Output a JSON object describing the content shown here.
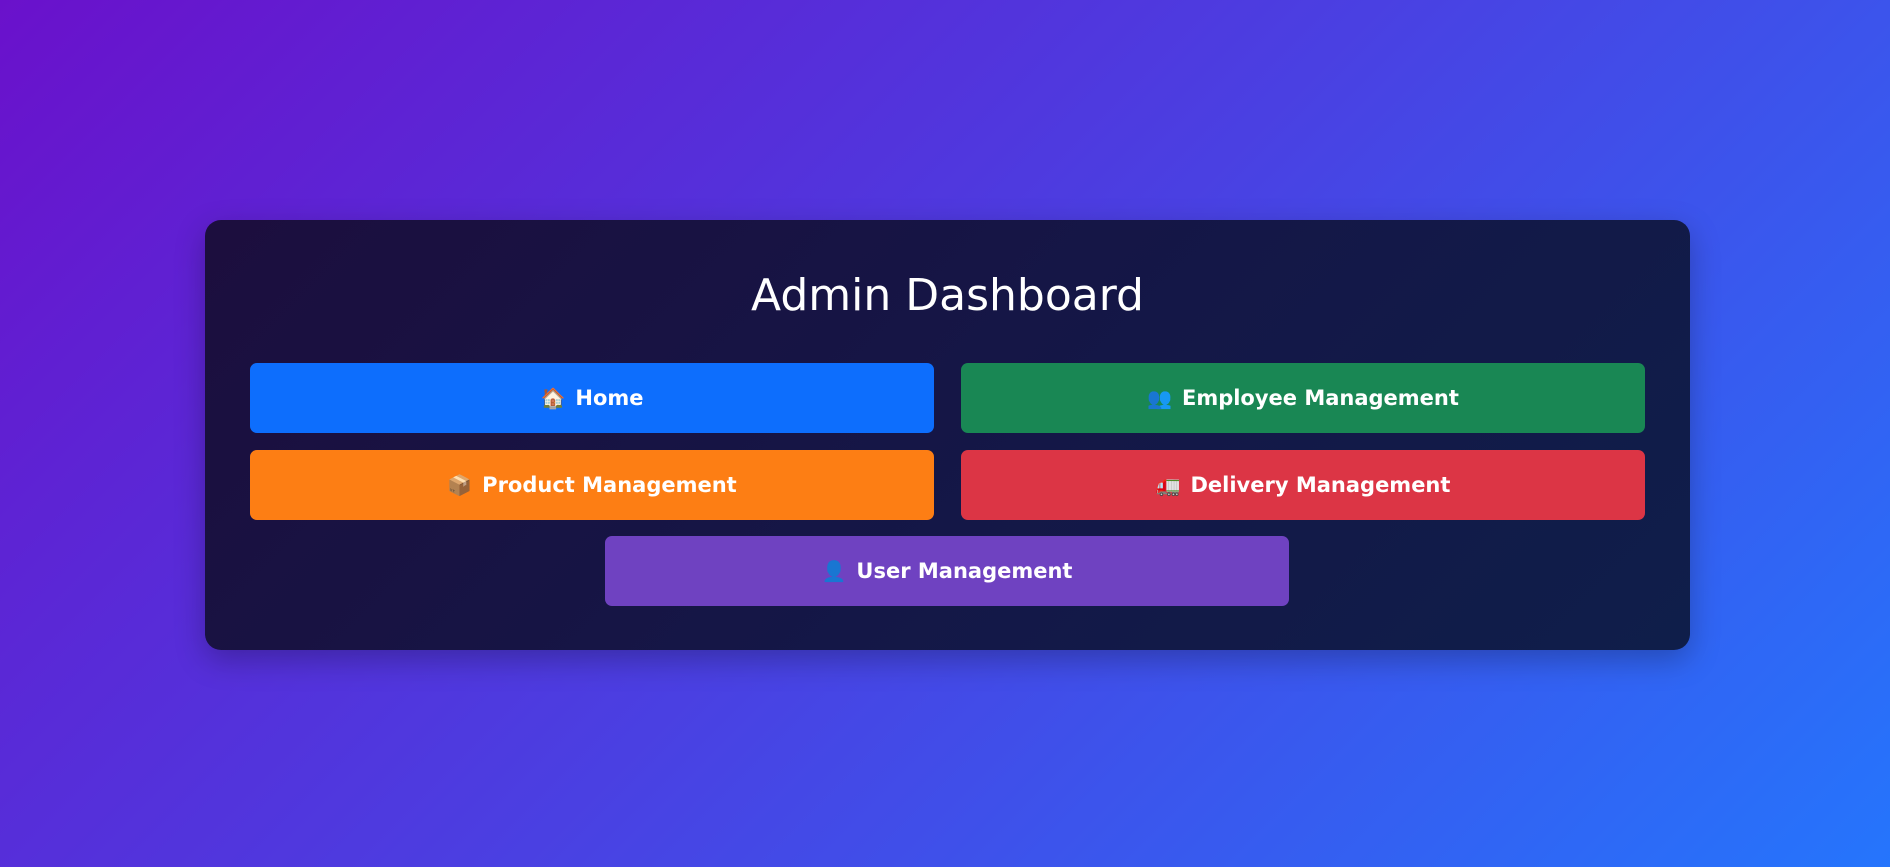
{
  "dashboard": {
    "title": "Admin Dashboard",
    "buttons": [
      {
        "label": "Home",
        "icon": "🏠",
        "icon_name": "home-icon",
        "color": "#0d6efd"
      },
      {
        "label": "Employee Management",
        "icon": "👥",
        "icon_name": "people-icon",
        "color": "#198754"
      },
      {
        "label": "Product Management",
        "icon": "📦",
        "icon_name": "package-icon",
        "color": "#fd7e14"
      },
      {
        "label": "Delivery Management",
        "icon": "🚛",
        "icon_name": "truck-icon",
        "color": "#dc3545"
      },
      {
        "label": "User Management",
        "icon": "👤",
        "icon_name": "user-icon",
        "color": "#6f42c1"
      }
    ]
  },
  "theme": {
    "background_start": "#6a11cb",
    "background_end": "#2575fc",
    "card_color": "#141747"
  }
}
